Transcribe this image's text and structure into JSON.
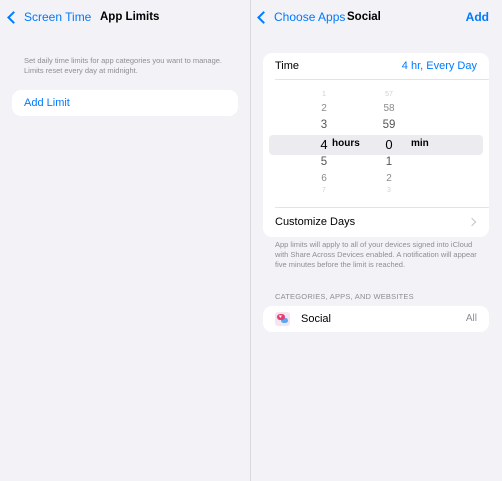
{
  "left": {
    "back_label": "Screen Time",
    "title": "App Limits",
    "description": "Set daily time limits for app categories you want to manage. Limits reset every day at midnight.",
    "add_limit_label": "Add Limit"
  },
  "right": {
    "back_label": "Choose Apps",
    "title": "Social",
    "action_label": "Add",
    "time_label": "Time",
    "time_value": "4 hr, Every Day",
    "picker": {
      "hours": [
        "1",
        "2",
        "3",
        "4",
        "5",
        "6",
        "7"
      ],
      "minutes": [
        "57",
        "58",
        "59",
        "0",
        "1",
        "2",
        "3"
      ],
      "hours_unit": "hours",
      "minutes_unit": "min",
      "selected_hours": "4",
      "selected_minutes": "0"
    },
    "customize_days_label": "Customize Days",
    "note": "App limits will apply to all of your devices signed into iCloud with Share Across Devices enabled. A notification will appear five minutes before the limit is reached.",
    "section_header": "CATEGORIES, APPS, AND WEBSITES",
    "category_label": "Social",
    "category_value": "All",
    "colors": {
      "accent": "#007aff",
      "secondary_text": "#8e8e93",
      "background": "#f2f2f7"
    },
    "icons": [
      "chevron-left-icon",
      "chevron-right-icon",
      "social-category-icon"
    ]
  }
}
